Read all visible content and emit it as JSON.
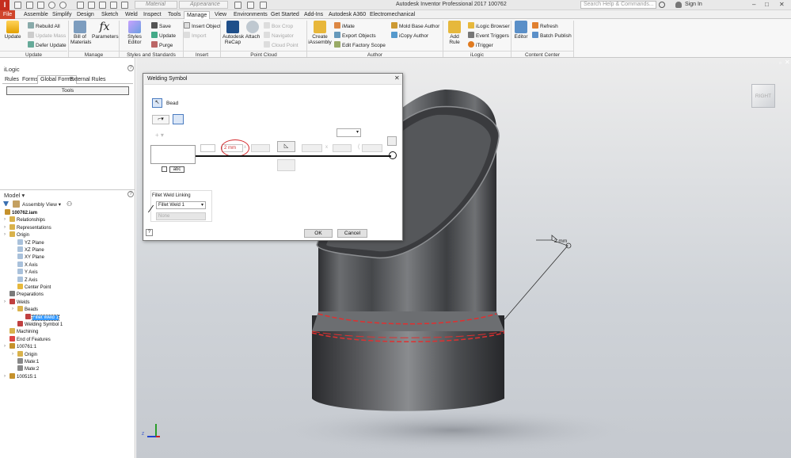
{
  "title_bar": {
    "material_placeholder": "Material",
    "appearance_placeholder": "Appearance",
    "app_title": "Autodesk Inventor Professional 2017   100762",
    "search_placeholder": "Search Help & Commands...",
    "sign_in": "Sign In"
  },
  "tabs": [
    "Assemble",
    "Simplify",
    "Design",
    "Sketch",
    "Weld",
    "Inspect",
    "Tools",
    "Manage",
    "View",
    "Environments",
    "Get Started",
    "Add-Ins",
    "Autodesk A360",
    "Electromechanical"
  ],
  "file_tab": "File",
  "active_tab": "Manage",
  "ribbon": {
    "update": {
      "update": "Update",
      "rebuild_all": "Rebuild All",
      "update_mass": "Update Mass",
      "defer_update": "Defer Update",
      "title": "Update"
    },
    "manage": {
      "bom": "Bill of\nMaterials",
      "parameters": "Parameters",
      "title": "Manage"
    },
    "styles": {
      "styles_editor": "Styles Editor",
      "save": "Save",
      "update": "Update",
      "purge": "Purge",
      "title": "Styles and Standards"
    },
    "insert": {
      "insert_object": "Insert Object",
      "import": "Import",
      "title": "Insert"
    },
    "point_cloud": {
      "recap": "Autodesk\nReCap",
      "attach": "Attach",
      "box_crop": "Box Crop",
      "navigator": "Navigator",
      "cloud_point": "Cloud Point",
      "title": "Point Cloud"
    },
    "author": {
      "create": "Create\niAssembly",
      "imate": "iMate",
      "export_objects": "Export Objects",
      "edit_factory": "Edit Factory Scope",
      "mold_base": "Mold Base Author",
      "icopy": "iCopy Author",
      "title": "Author"
    },
    "ilogic": {
      "add_rule": "Add Rule",
      "browser": "iLogic Browser",
      "event_triggers": "Event Triggers",
      "itrigger": "iTrigger",
      "title": "iLogic"
    },
    "content_center": {
      "editor": "Editor",
      "refresh": "Refresh",
      "batch_publish": "Batch Publish",
      "title": "Content Center"
    }
  },
  "ilogic_panel": {
    "title": "iLogic",
    "tabs": [
      "Rules",
      "Forms",
      "Global Forms",
      "External Rules"
    ],
    "tools_button": "Tools"
  },
  "model_panel": {
    "title": "Model",
    "view": "Assembly View",
    "tree": [
      {
        "label": "100762.iam",
        "bold": true
      },
      {
        "label": "Relationships"
      },
      {
        "label": "Representations"
      },
      {
        "label": "Origin"
      },
      {
        "label": "YZ Plane"
      },
      {
        "label": "XZ Plane"
      },
      {
        "label": "XY Plane"
      },
      {
        "label": "X Axis"
      },
      {
        "label": "Y Axis"
      },
      {
        "label": "Z Axis"
      },
      {
        "label": "Center Point"
      },
      {
        "label": "Preparations"
      },
      {
        "label": "Welds"
      },
      {
        "label": "Beads"
      },
      {
        "label": "Fillet Weld 1",
        "selected": true
      },
      {
        "label": "Welding Symbol 1"
      },
      {
        "label": "Machining"
      },
      {
        "label": "End of Features"
      },
      {
        "label": "100761:1"
      },
      {
        "label": "Origin"
      },
      {
        "label": "Mate:1"
      },
      {
        "label": "Mate:2"
      },
      {
        "label": "100515:1"
      }
    ]
  },
  "dialog": {
    "title": "Welding Symbol",
    "bead_label": "Bead",
    "size_value": "2 mm",
    "x_label": "x",
    "fillet_group": "Fillet Weld Linking",
    "fillet_select": "Fillet Weld 1",
    "none_value": "None",
    "ok": "OK",
    "cancel": "Cancel",
    "help": "?",
    "abc": "abc"
  },
  "viewport": {
    "viewcube_label": "RIGHT",
    "annotation": "2 mm",
    "weld_color": "#e03030",
    "highlight_color": "#d4262a"
  }
}
